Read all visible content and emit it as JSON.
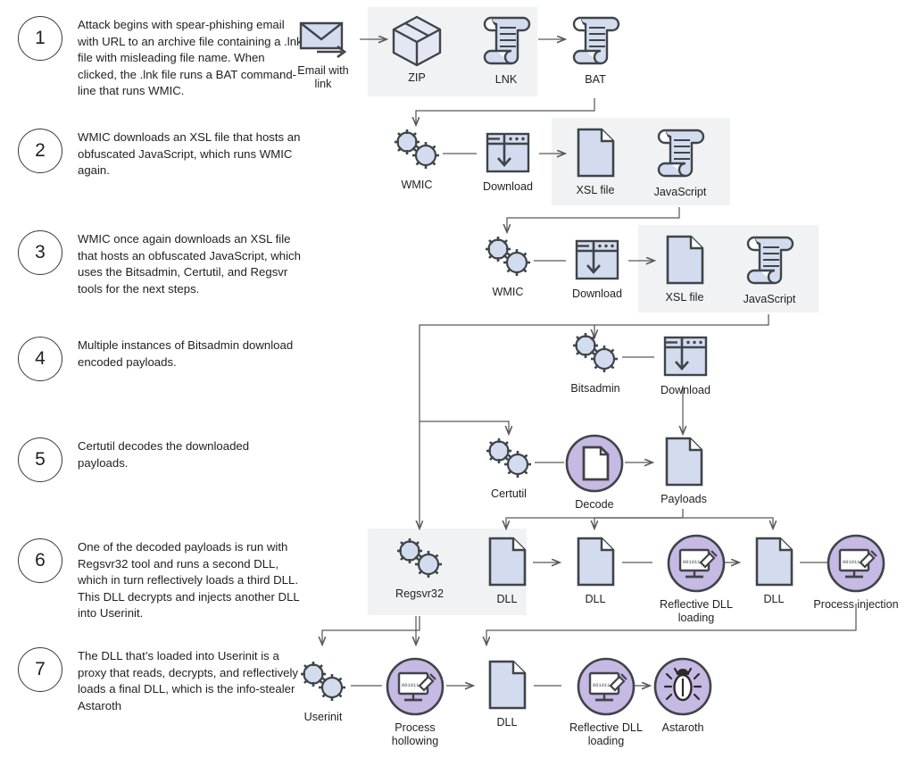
{
  "steps": [
    {
      "num": "1",
      "text": "Attack begins with spear-phishing email with URL to an archive file containing  a .lnk file with misleading file name. When clicked, the .lnk file runs a BAT command-line that runs WMIC."
    },
    {
      "num": "2",
      "text": "WMIC downloads an XSL file that hosts an obfuscated JavaScript, which runs WMIC again."
    },
    {
      "num": "3",
      "text": "WMIC once again downloads an XSL file that hosts an obfuscated JavaScript, which uses the Bitsadmin, Certutil, and Regsvr tools for the next steps."
    },
    {
      "num": "4",
      "text": "Multiple instances of Bitsadmin download encoded payloads."
    },
    {
      "num": "5",
      "text": "Certutil decodes the downloaded payloads."
    },
    {
      "num": "6",
      "text": "One of the decoded payloads is run with Regsvr32 tool and runs a second DLL, which in turn reflectively loads a third DLL. This DLL decrypts and injects another DLL into Userinit."
    },
    {
      "num": "7",
      "text": "The DLL that’s loaded into Userinit is a proxy that reads, decrypts, and reflectively loads a final DLL, which is the info-stealer Astaroth"
    }
  ],
  "nodes": {
    "email": "Email with\nlink",
    "zip": "ZIP",
    "lnk": "LNK",
    "bat": "BAT",
    "wmic1": "WMIC",
    "download1": "Download",
    "xsl1": "XSL file",
    "javascript1": "JavaScript",
    "wmic2": "WMIC",
    "download2": "Download",
    "xsl2": "XSL file",
    "javascript2": "JavaScript",
    "bitsadmin": "Bitsadmin",
    "download3": "Download",
    "certutil": "Certutil",
    "decode": "Decode",
    "payloads": "Payloads",
    "regsvr32": "Regsvr32",
    "dll1": "DLL",
    "dll2": "DLL",
    "reflective1": "Reflective DLL\nloading",
    "dll3": "DLL",
    "process_injection": "Process injection",
    "userinit": "Userinit",
    "process_hollowing": "Process\nhollowing",
    "dll4": "DLL",
    "reflective2": "Reflective DLL\nloading",
    "astaroth": "Astaroth"
  },
  "colors": {
    "icon_fill": "#d3dcef",
    "icon_stroke": "#3f4448",
    "purple": "#c6b9e3",
    "highlight": "#f1f2f4",
    "connector": "#595959",
    "text": "#1f1f1f"
  }
}
